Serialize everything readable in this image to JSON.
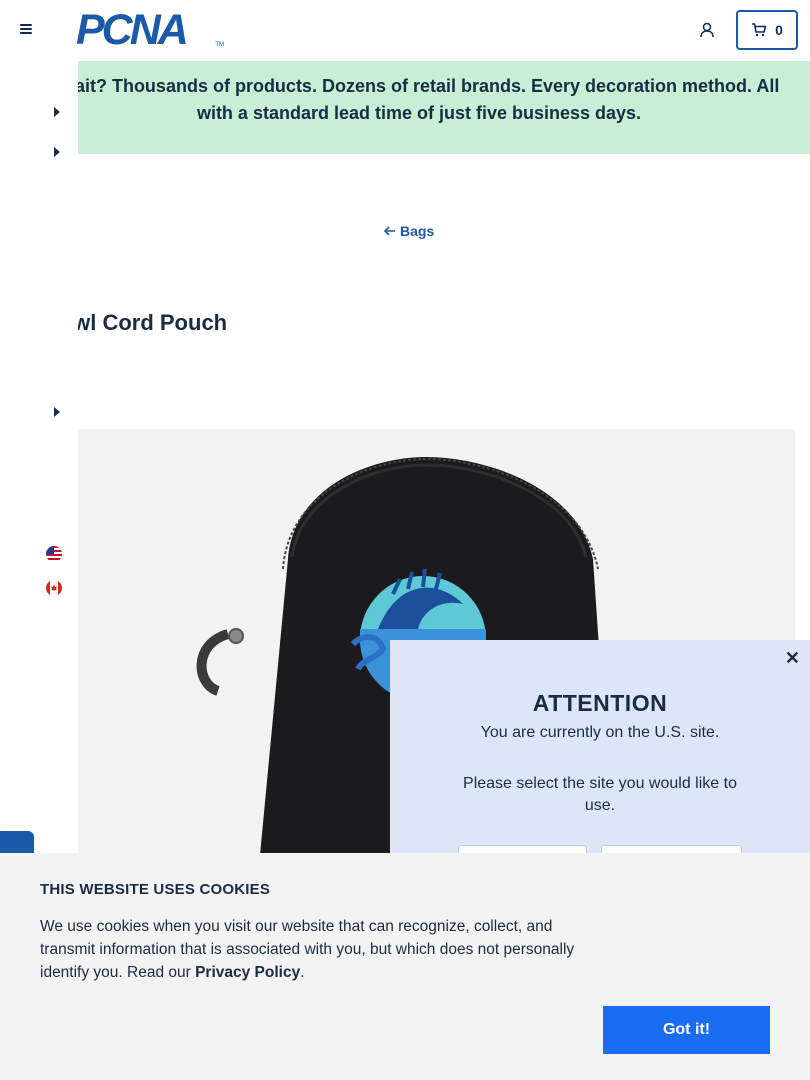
{
  "header": {
    "logo_text": "PCNA",
    "logo_tm": "TM",
    "cart_count": "0"
  },
  "banner": {
    "text": "Wait? Thousands of products. Dozens of retail brands. Every decoration method. All with a standard lead time of just five business days."
  },
  "breadcrumb": {
    "back_label": "Bags"
  },
  "product": {
    "title": "Owl Cord Pouch"
  },
  "modal": {
    "close_label": "✕",
    "title": "ATTENTION",
    "line1": "You are currently on the U.S. site.",
    "line2": "Please select the site you would like to use."
  },
  "cookie": {
    "title": "THIS WEBSITE USES COOKIES",
    "text_before": "We use cookies when you visit our website that can recognize, collect, and transmit information that is associated with you, but which does not personally identify you. Read our ",
    "privacy_link": "Privacy Policy",
    "text_after": ".",
    "button_label": "Got it!"
  },
  "colors": {
    "brand_blue": "#1c5aa8",
    "banner_green": "#c8eed6",
    "modal_bg": "#dde6f7",
    "cookie_bg": "#f3f3f3",
    "cta_blue": "#1a6cf0"
  },
  "icons": [
    "menu-icon",
    "user-icon",
    "cart-icon",
    "caret-right-icon",
    "arrow-left-icon",
    "us-flag-icon",
    "canada-flag-icon",
    "close-icon"
  ]
}
